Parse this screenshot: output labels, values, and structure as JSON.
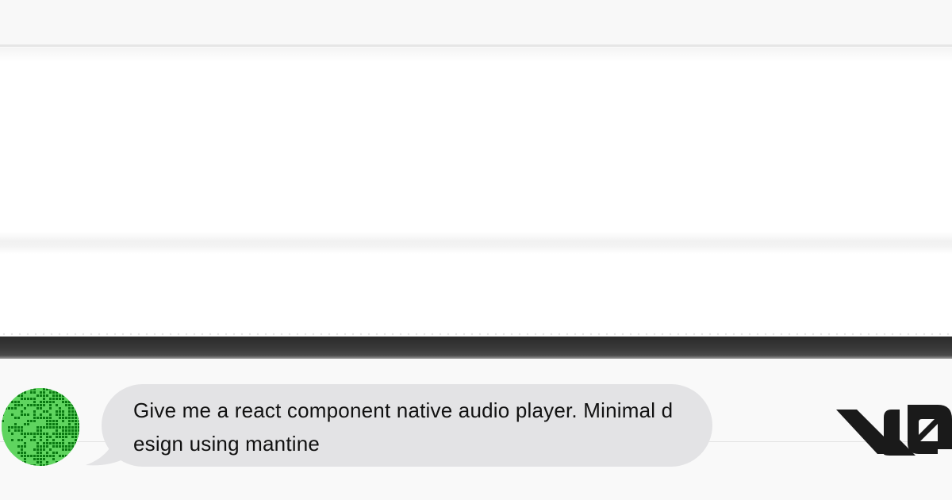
{
  "chat": {
    "user_message": "Give me a react component native audio player. Minimal design using mantine"
  },
  "brand": {
    "logo_name": "v0-logo-icon"
  },
  "avatar": {
    "icon": "user-avatar-icon",
    "colors": {
      "light_green": "#5fd45f",
      "dark_green": "#0a7a12"
    }
  },
  "colors": {
    "bubble_background": "#e3e3e5",
    "dark_divider": "#2a2a2a",
    "page_background": "#fafafa",
    "text": "#111111"
  }
}
